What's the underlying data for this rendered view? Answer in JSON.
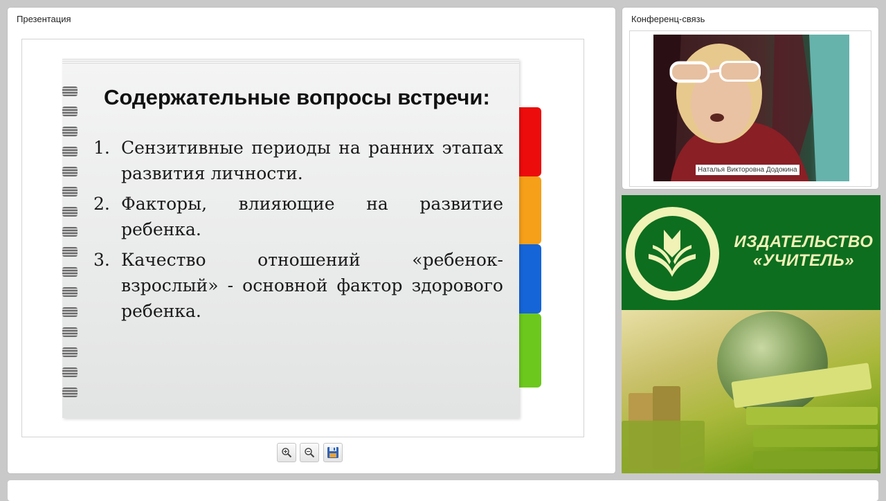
{
  "presentation": {
    "title": "Презентация",
    "slide": {
      "heading": "Содержательные вопросы встречи:",
      "items": [
        {
          "num": "1.",
          "text": "Сензитивные периоды на ранних этапах развития личности."
        },
        {
          "num": "2.",
          "text": "Факторы, влияющие на развитие ребенка."
        },
        {
          "num": "3.",
          "text": "Качество отношений «ребенок-взрослый» - основной фактор здорового ребенка."
        }
      ],
      "tab_colors": [
        "#ec0c0c",
        "#f5a018",
        "#1565d8",
        "#6cc81c"
      ]
    },
    "toolbar": {
      "zoom_in_icon": "zoom-in-icon",
      "zoom_out_icon": "zoom-out-icon",
      "save_icon": "save-icon"
    }
  },
  "conference": {
    "title": "Конференц-связь",
    "participant_name": "Наталья Викторовна Додокина"
  },
  "publisher": {
    "name_line1": "ИЗДАТЕЛЬСТВО",
    "name_line2": "«УЧИТЕЛЬ»",
    "colors": {
      "background": "#0d6e1f",
      "text": "#f1f1b8"
    }
  }
}
